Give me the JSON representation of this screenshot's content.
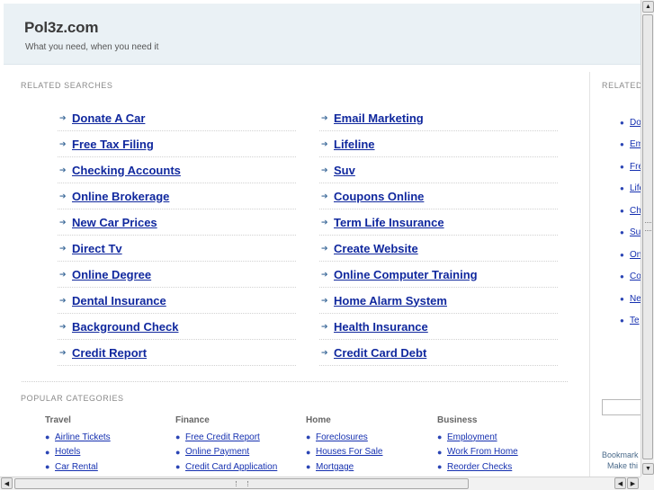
{
  "header": {
    "title": "Pol3z.com",
    "tagline": "What you need, when you need it"
  },
  "related": {
    "label": "RELATED SEARCHES",
    "left": [
      "Donate A Car",
      "Free Tax Filing",
      "Checking Accounts",
      "Online Brokerage",
      "New Car Prices",
      "Direct Tv",
      "Online Degree",
      "Dental Insurance",
      "Background Check",
      "Credit Report"
    ],
    "right": [
      "Email Marketing",
      "Lifeline",
      "Suv",
      "Coupons Online",
      "Term Life Insurance",
      "Create Website",
      "Online Computer Training",
      "Home Alarm System",
      "Health Insurance",
      "Credit Card Debt"
    ]
  },
  "popular": {
    "label": "POPULAR CATEGORIES",
    "columns": [
      {
        "heading": "Travel",
        "items": [
          "Airline Tickets",
          "Hotels",
          "Car Rental"
        ]
      },
      {
        "heading": "Finance",
        "items": [
          "Free Credit Report",
          "Online Payment",
          "Credit Card Application"
        ]
      },
      {
        "heading": "Home",
        "items": [
          "Foreclosures",
          "Houses For Sale",
          "Mortgage"
        ]
      },
      {
        "heading": "Business",
        "items": [
          "Employment",
          "Work From Home",
          "Reorder Checks"
        ]
      }
    ]
  },
  "sidebar": {
    "label": "RELATED",
    "items": [
      "Do",
      "Em",
      "Fre",
      "Life",
      "Ch",
      "Su",
      "On",
      "Co",
      "Ne",
      "Te"
    ],
    "bookmark_line1": "Bookmark",
    "bookmark_line2": "Make thi"
  },
  "icons": {
    "arrow": "right-arrow-icon",
    "bullet": "bullet-icon"
  },
  "colors": {
    "header_bg": "#eaf1f5",
    "link": "#10289e",
    "label": "#8a8a8a"
  }
}
